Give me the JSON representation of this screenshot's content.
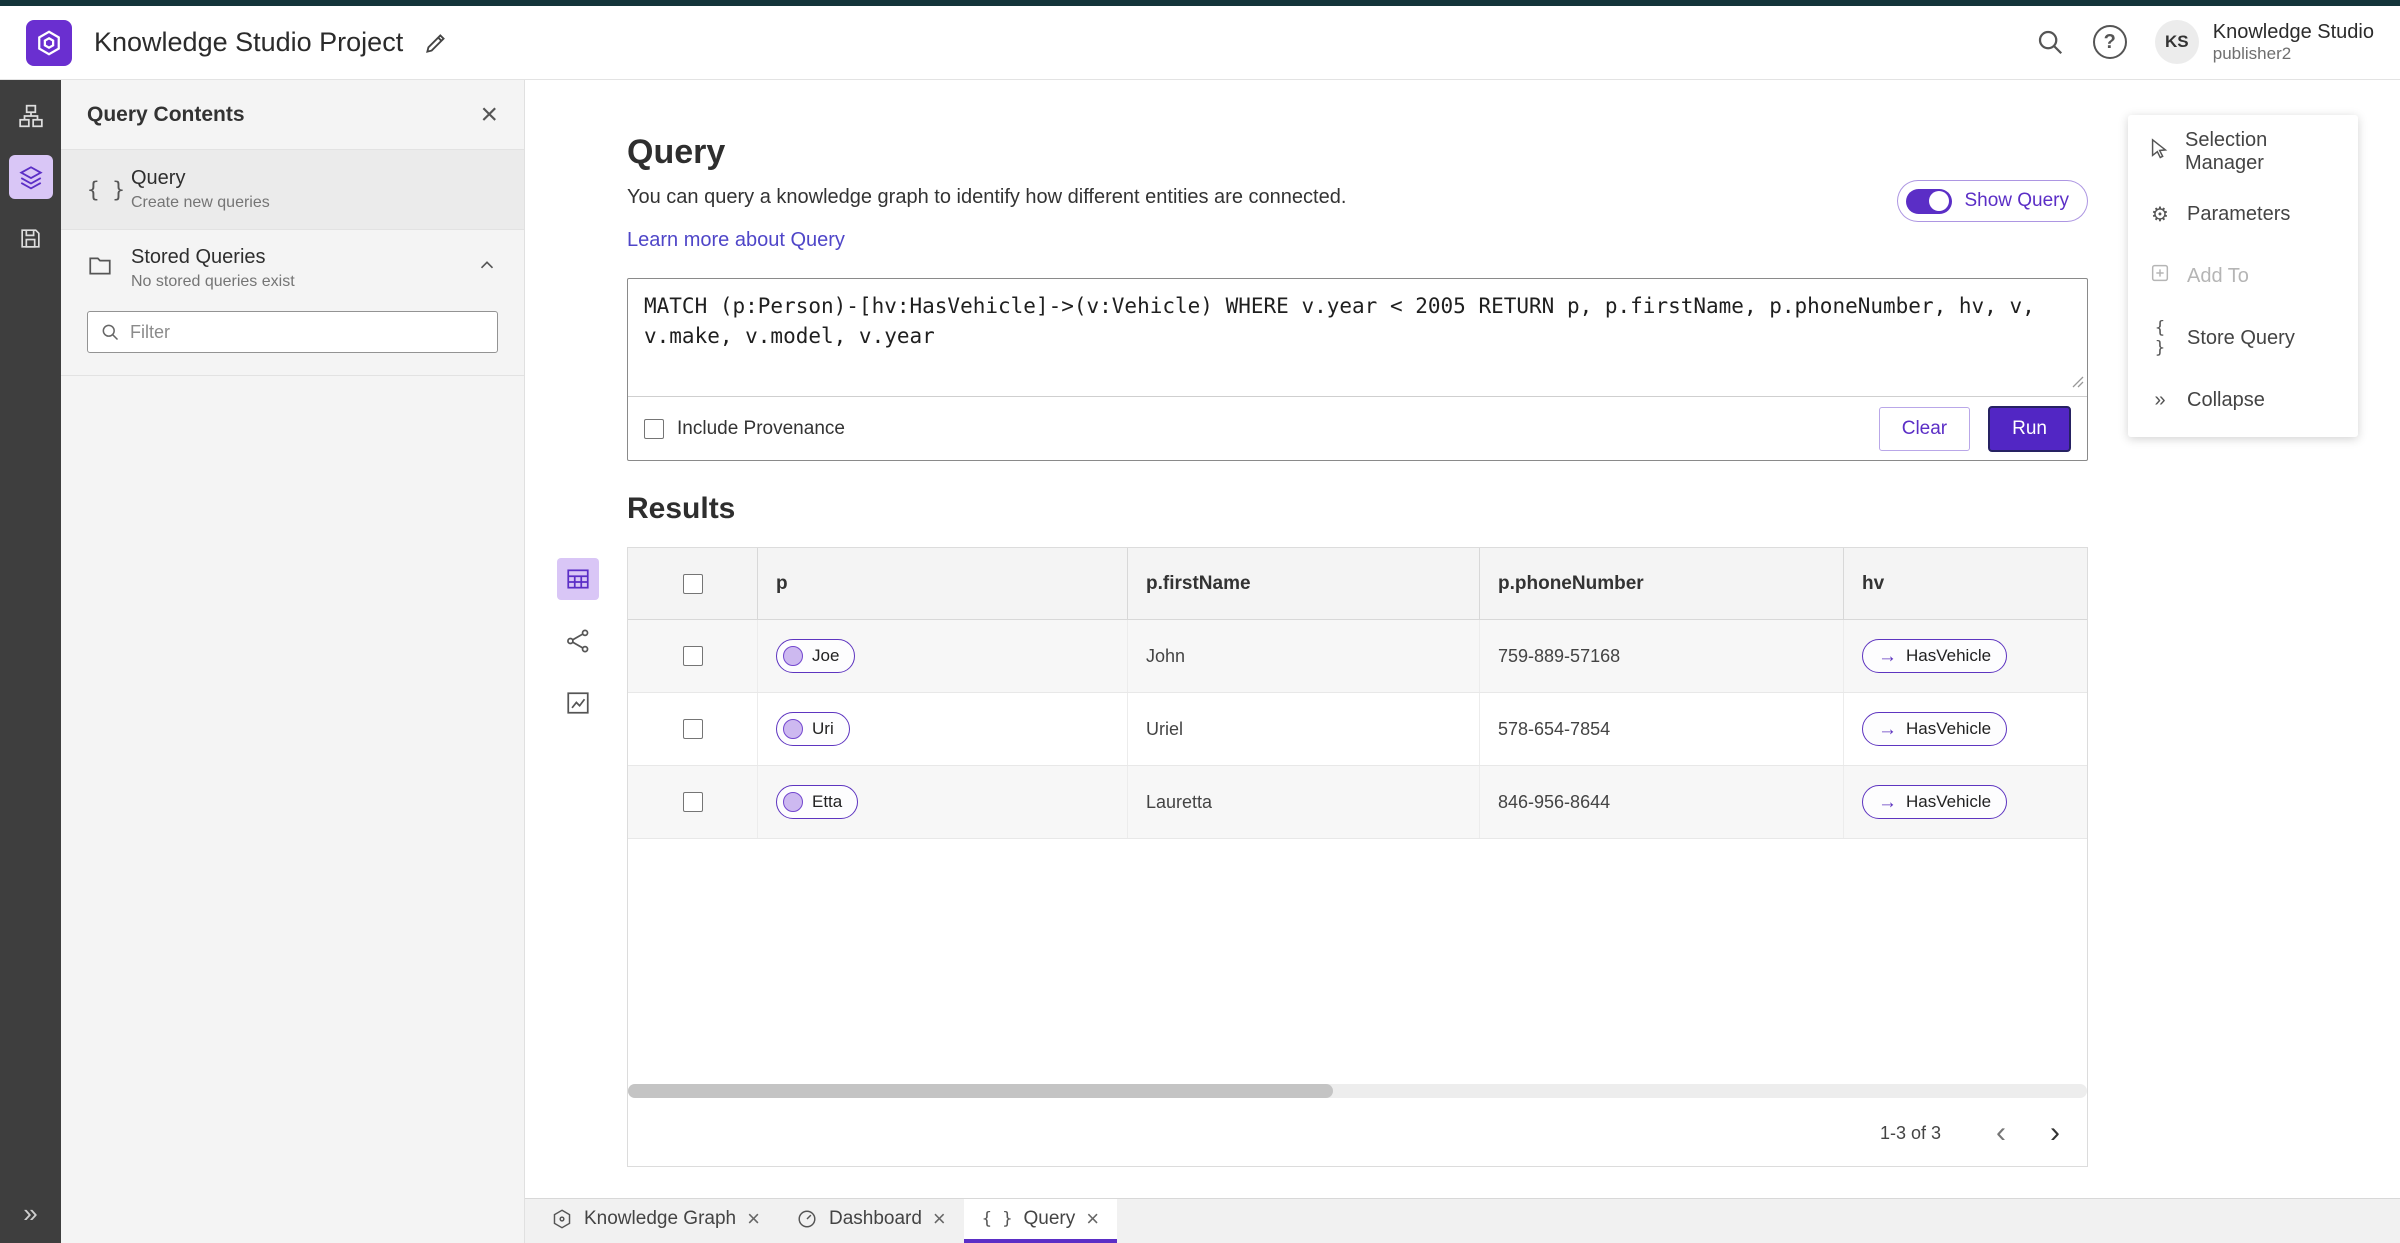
{
  "colors": {
    "accent": "#5b2ec6",
    "accent_dark": "#262262",
    "light_purple": "#d9c6f6",
    "link": "#4f46c8"
  },
  "icons": {
    "braces": "{ }",
    "close": "×",
    "arrow_right": "→",
    "chevron_left": "‹",
    "chevron_right": "›",
    "collapse": "»",
    "gear": "⚙",
    "question": "?"
  },
  "header": {
    "app_title": "Knowledge Studio Project",
    "avatar_initials": "KS",
    "user_name": "Knowledge Studio",
    "user_sub": "publisher2"
  },
  "sidebar": {
    "title": "Query Contents",
    "query_item": {
      "label": "Query",
      "sublabel": "Create new queries"
    },
    "stored": {
      "label": "Stored Queries",
      "sublabel": "No stored queries exist"
    },
    "filter_placeholder": "Filter"
  },
  "main": {
    "title": "Query",
    "description": "You can query a knowledge graph to identify how different entities are connected.",
    "learn_link": "Learn more about Query",
    "show_query_label": "Show Query",
    "query_text": "MATCH (p:Person)-[hv:HasVehicle]->(v:Vehicle) WHERE v.year < 2005 RETURN p, p.firstName, p.phoneNumber, hv, v, v.make, v.model, v.year",
    "include_provenance": "Include Provenance",
    "clear_label": "Clear",
    "run_label": "Run",
    "results_title": "Results"
  },
  "table": {
    "columns": [
      "p",
      "p.firstName",
      "p.phoneNumber",
      "hv"
    ],
    "rows": [
      {
        "node": "Joe",
        "first_name": "John",
        "phone": "759-889-57168",
        "edge": "HasVehicle"
      },
      {
        "node": "Uri",
        "first_name": "Uriel",
        "phone": "578-654-7854",
        "edge": "HasVehicle"
      },
      {
        "node": "Etta",
        "first_name": "Lauretta",
        "phone": "846-956-8644",
        "edge": "HasVehicle"
      }
    ],
    "pagination": "1-3 of 3"
  },
  "context_menu": {
    "items": [
      {
        "label": "Selection Manager"
      },
      {
        "label": "Parameters"
      },
      {
        "label": "Add To"
      },
      {
        "label": "Store Query"
      },
      {
        "label": "Collapse"
      }
    ]
  },
  "tabs": [
    {
      "label": "Knowledge Graph"
    },
    {
      "label": "Dashboard"
    },
    {
      "label": "Query"
    }
  ]
}
